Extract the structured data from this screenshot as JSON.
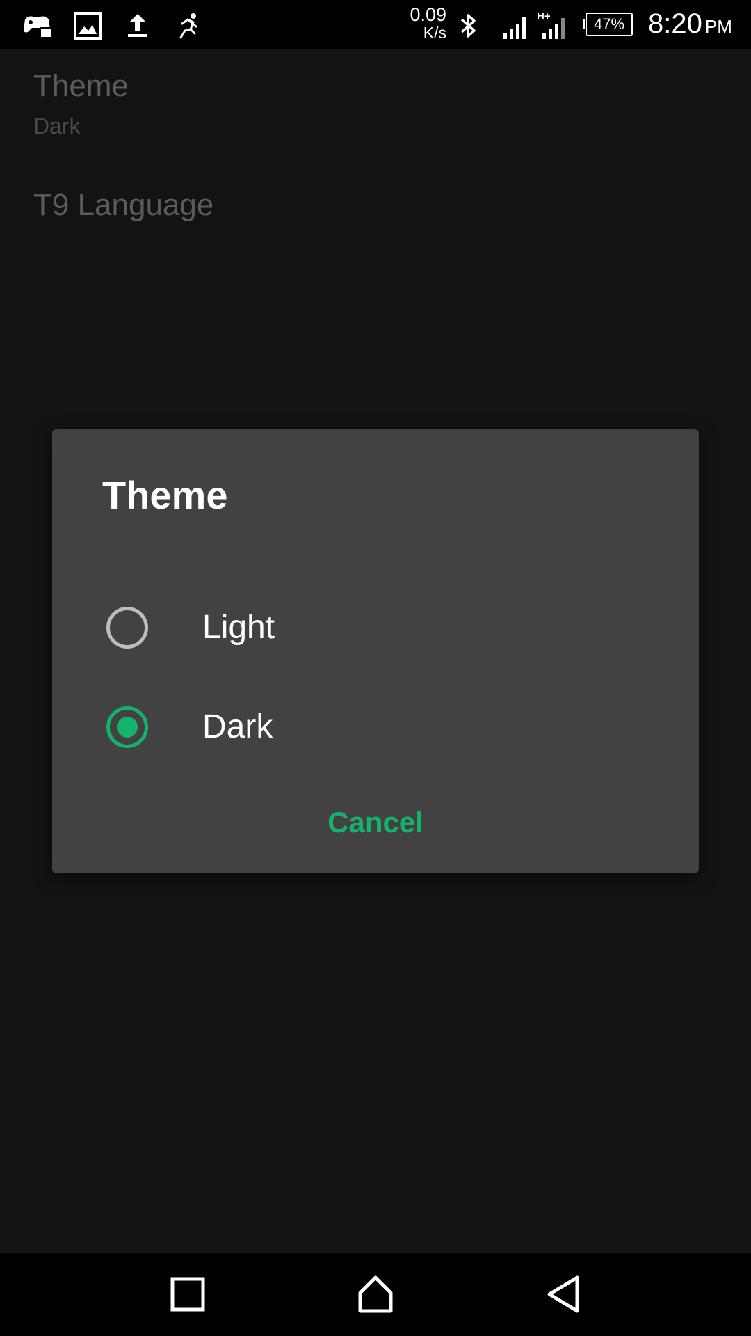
{
  "status_bar": {
    "net_speed_value": "0.09",
    "net_speed_unit": "K/s",
    "battery_percent": "47%",
    "time": "8:20",
    "ampm": "PM",
    "notification_icons": [
      "game-controller-icon",
      "image-icon",
      "upload-icon",
      "running-figure-icon"
    ],
    "system_icons": [
      "bluetooth-icon",
      "signal-icon",
      "hplus-signal-icon",
      "battery-icon"
    ]
  },
  "settings": {
    "theme": {
      "title": "Theme",
      "summary": "Dark"
    },
    "t9_language": {
      "title": "T9 Language"
    }
  },
  "dialog": {
    "title": "Theme",
    "options": [
      {
        "label": "Light",
        "selected": false
      },
      {
        "label": "Dark",
        "selected": true
      }
    ],
    "cancel_label": "Cancel"
  },
  "nav_bar": {
    "buttons": [
      "recents-square-icon",
      "home-icon",
      "back-triangle-icon"
    ]
  },
  "colors": {
    "accent": "#14b26b",
    "dialog_bg": "#424242",
    "screen_bg": "#131313",
    "bars_bg": "#000000"
  }
}
